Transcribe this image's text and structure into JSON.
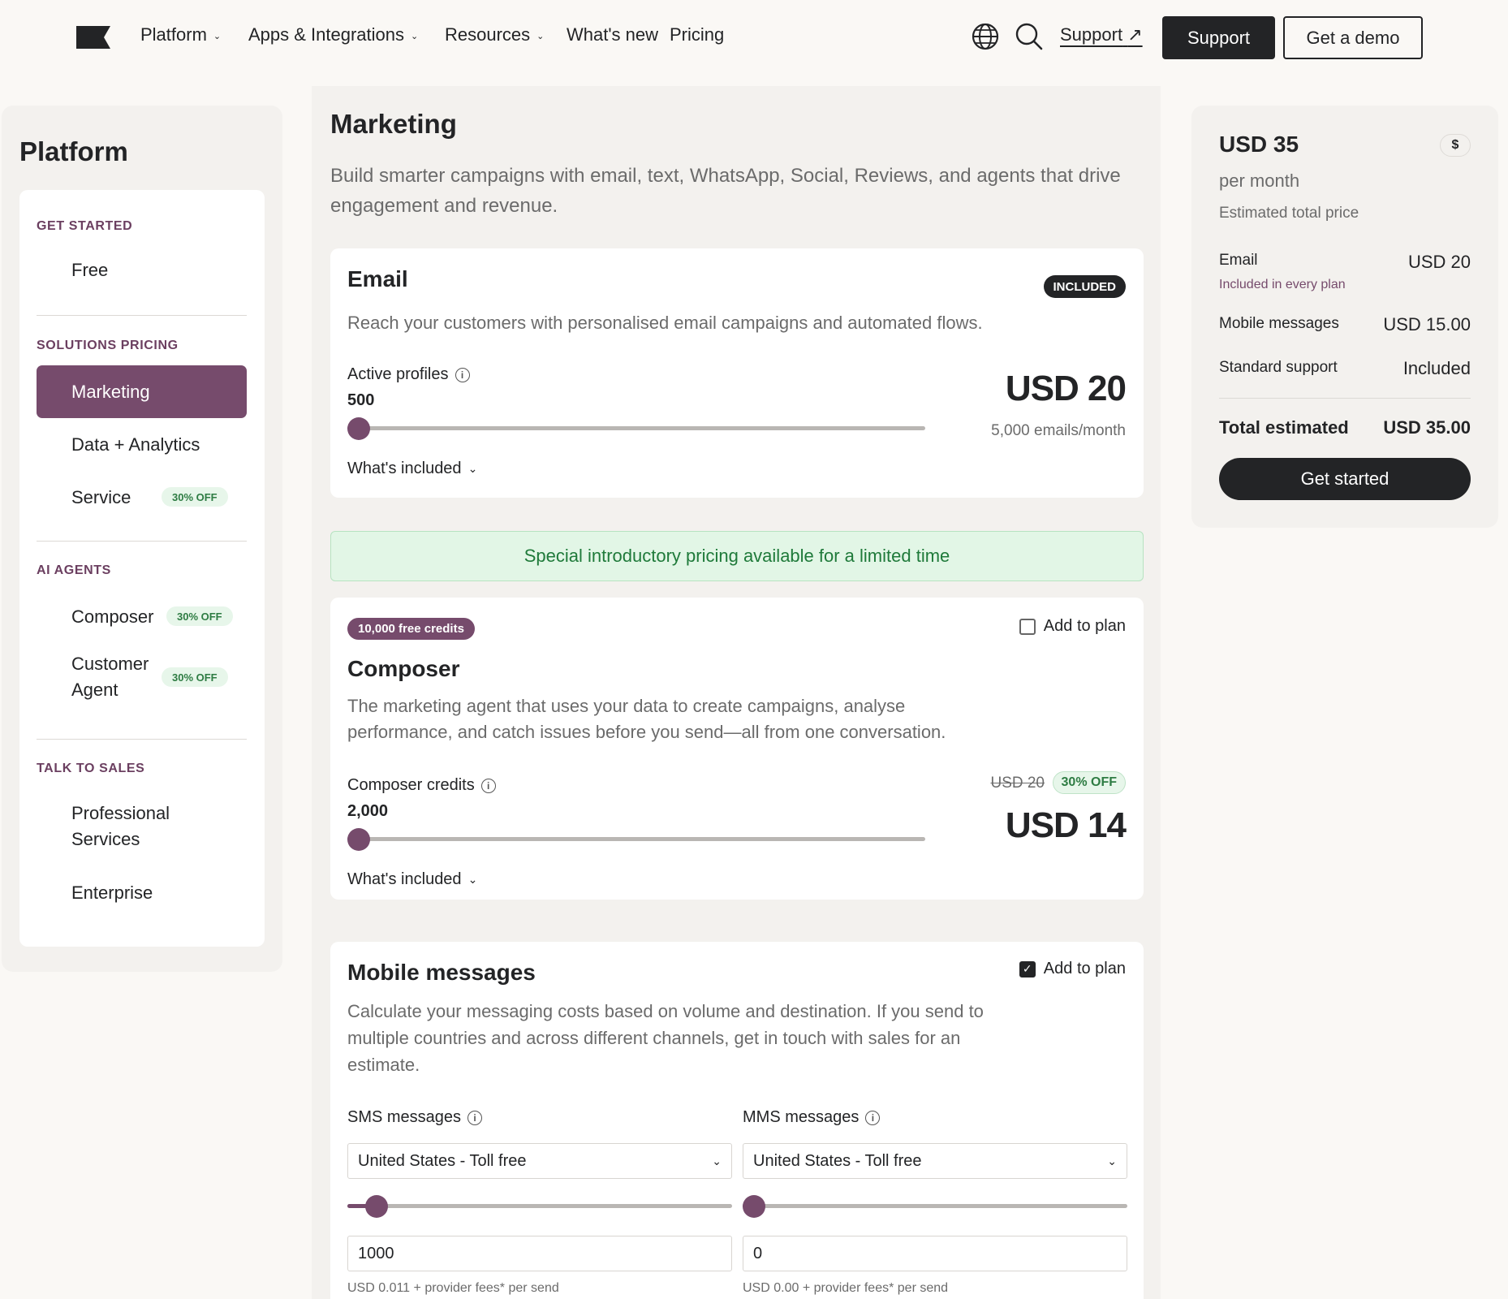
{
  "nav": {
    "items": [
      {
        "label": "Platform",
        "has_dropdown": true
      },
      {
        "label": "Apps & Integrations",
        "has_dropdown": true
      },
      {
        "label": "Resources",
        "has_dropdown": true
      },
      {
        "label": "What's new",
        "has_dropdown": false
      },
      {
        "label": "Pricing",
        "has_dropdown": false
      }
    ],
    "icons": {
      "language": "globe-icon",
      "search": "search-icon",
      "external": "external-link-icon",
      "logo": "brand-flag-logo"
    },
    "support_link": "Support",
    "support_button": "Support",
    "demo_button": "Get a demo"
  },
  "sidebar": {
    "title": "Platform",
    "sections": {
      "get_started": "GET STARTED",
      "solutions": "SOLUTIONS PRICING",
      "ai_agents": "AI AGENTS",
      "talk_to_sales": "TALK TO SALES"
    },
    "items": {
      "free": "Free",
      "marketing": "Marketing",
      "data_analytics": "Data + Analytics",
      "service": "Service",
      "composer": "Composer",
      "customer_agent_1": "Customer",
      "customer_agent_2": "Agent",
      "professional_1": "Professional",
      "professional_2": "Services",
      "enterprise": "Enterprise"
    },
    "badges": {
      "service": "30% OFF",
      "composer": "30% OFF",
      "customer_agent": "30% OFF"
    },
    "active": "Marketing"
  },
  "main": {
    "title": "Marketing",
    "subtitle": "Build smarter campaigns with email, text, WhatsApp, Social, Reviews, and agents that drive engagement and revenue.",
    "email": {
      "title": "Email",
      "badge": "INCLUDED",
      "description": "Reach your customers with personalised email campaigns and automated flows.",
      "slider_label": "Active profiles",
      "slider_value": "500",
      "slider_level": 0.0,
      "price": "USD 20",
      "price_note": "5,000 emails/month",
      "whats_included": "What's included"
    },
    "promo": "Special introductory pricing available for a limited time",
    "composer": {
      "badge": "10,000 free credits",
      "add_to_plan": "Add to plan",
      "checked": false,
      "title": "Composer",
      "description_1": "The marketing agent that uses your data to create campaigns, analyse",
      "description_2": "performance, and catch issues before you send—all from one conversation.",
      "slider_label": "Composer credits",
      "slider_value": "2,000",
      "slider_level": 0.0,
      "old_price": "USD 20",
      "discount": "30% OFF",
      "price": "USD 14",
      "whats_included": "What's included"
    },
    "mobile": {
      "title": "Mobile messages",
      "add_to_plan": "Add to plan",
      "checked": true,
      "description_1": "Calculate your messaging costs based on volume and destination. If you send to",
      "description_2": "multiple countries and across different channels, get in touch with sales for an",
      "description_3": "estimate.",
      "sms_label": "SMS messages",
      "mms_label": "MMS messages",
      "sms_select": "United States - Toll free",
      "mms_select": "United States - Toll free",
      "sms_level": 0.05,
      "mms_level": 0.0,
      "sms_value": "1000",
      "mms_value": "0",
      "sms_fee": "USD 0.011 + provider fees* per send",
      "mms_fee": "USD 0.00 + provider fees* per send"
    }
  },
  "summary": {
    "price": "USD 35",
    "currency_icon": "$",
    "per_month": "per month",
    "estimated": "Estimated total price",
    "rows": [
      {
        "label": "Email",
        "value": "USD 20",
        "note": "Included in every plan"
      },
      {
        "label": "Mobile messages",
        "value": "USD 15.00"
      },
      {
        "label": "Standard support",
        "value": "Included"
      }
    ],
    "total_label": "Total estimated",
    "total_value": "USD 35.00",
    "cta": "Get started"
  },
  "colors": {
    "accent": "#764b6c",
    "dark": "#232426",
    "promo_green": "#1f7a3a",
    "badge_green": "#2e7c43"
  }
}
